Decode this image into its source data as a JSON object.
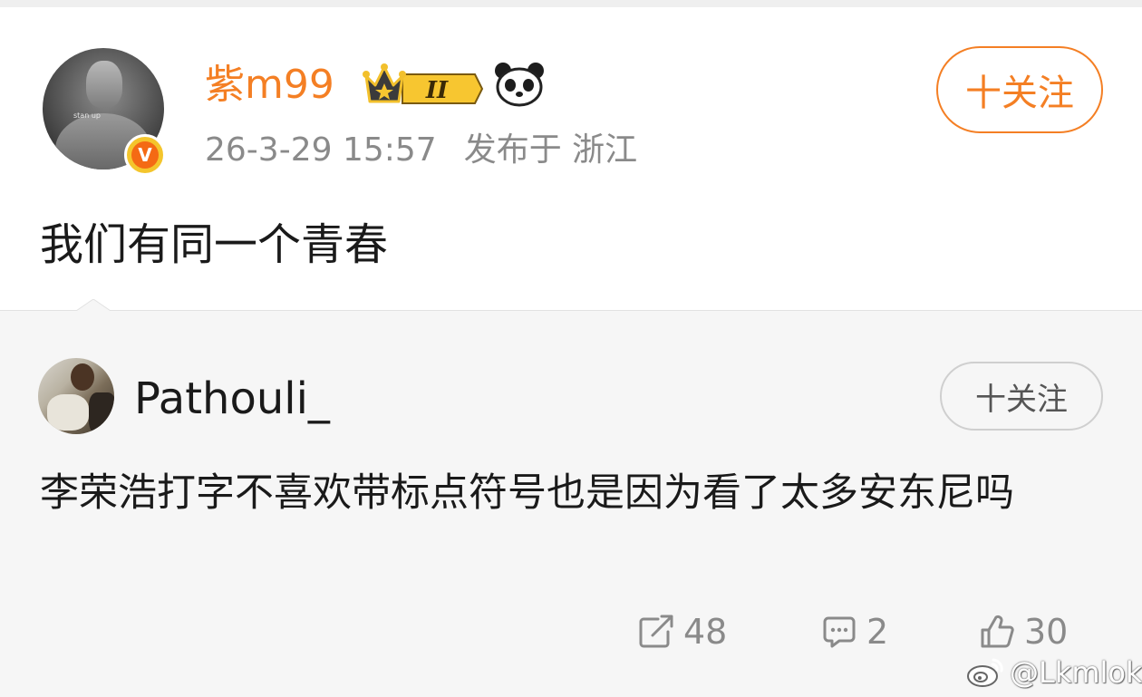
{
  "post": {
    "username": "紫m99",
    "level_badge": "II",
    "verified_badge": "V",
    "avatar_caption": "stan up",
    "timestamp": "26-3-29 15:57",
    "location": "发布于 浙江",
    "follow_label": "十关注",
    "content": "我们有同一个青春",
    "accent_color": "#f47f24",
    "icons": [
      "crown-level-icon",
      "panda-icon",
      "verified-v-icon"
    ]
  },
  "repost": {
    "username": "Pathouli_",
    "follow_label": "十关注",
    "content": "李荣浩打字不喜欢带标点符号也是因为看了太多安东尼吗"
  },
  "actions": {
    "share_count": "48",
    "comment_count": "2",
    "like_count": "30",
    "icons": [
      "share-icon",
      "comment-icon",
      "like-icon"
    ]
  },
  "watermark": {
    "text": "@Lkmlok",
    "icon": "weibo-logo-icon"
  }
}
